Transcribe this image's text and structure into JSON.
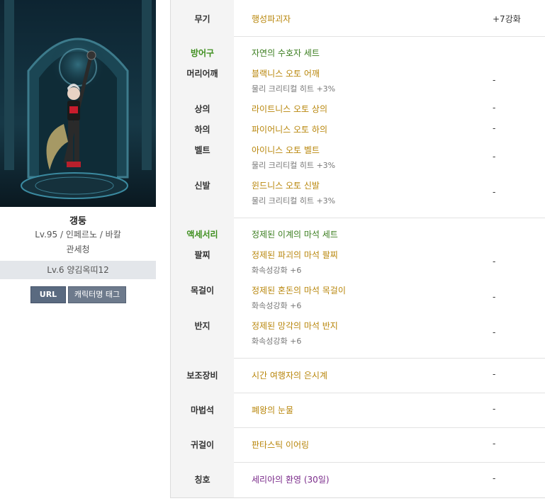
{
  "character": {
    "name": "갱둥",
    "info": "Lv.95 / 인페르노 / 바칼",
    "guild": "관세청",
    "mercenary": "Lv.6 양김옥띠12",
    "buttons": {
      "url": "URL",
      "tag": "캐릭터명 태그"
    }
  },
  "weapon": {
    "slot": "무기",
    "name": "행성파괴자",
    "value": "+7강화"
  },
  "armor": {
    "category": "방어구",
    "set_name": "자연의 수호자 세트",
    "items": [
      {
        "slot": "머리어깨",
        "name": "블랙니스 오토 어깨",
        "sub": "물리 크리티컬 히트 +3%",
        "value": "-"
      },
      {
        "slot": "상의",
        "name": "라이트니스 오토 상의",
        "sub": "",
        "value": "-"
      },
      {
        "slot": "하의",
        "name": "파이어니스 오토 하의",
        "sub": "",
        "value": "-"
      },
      {
        "slot": "벨트",
        "name": "아이니스 오토 벨트",
        "sub": "물리 크리티컬 히트 +3%",
        "value": "-"
      },
      {
        "slot": "신발",
        "name": "윈드니스 오토 신발",
        "sub": "물리 크리티컬 히트 +3%",
        "value": "-"
      }
    ]
  },
  "accessory": {
    "category": "액세서리",
    "set_name": "정제된 이계의 마석 세트",
    "items": [
      {
        "slot": "팔찌",
        "name": "정제된 파괴의 마석 팔찌",
        "sub": "화속성강화 +6",
        "value": "-"
      },
      {
        "slot": "목걸이",
        "name": "정제된 혼돈의 마석 목걸이",
        "sub": "화속성강화 +6",
        "value": "-"
      },
      {
        "slot": "반지",
        "name": "정제된 망각의 마석 반지",
        "sub": "화속성강화 +6",
        "value": "-"
      }
    ]
  },
  "others": [
    {
      "slot": "보조장비",
      "name": "시간 여행자의 은시계",
      "value": "-"
    },
    {
      "slot": "마법석",
      "name": "폐왕의 눈물",
      "value": "-"
    },
    {
      "slot": "귀걸이",
      "name": "판타스틱 이어링",
      "value": "-"
    },
    {
      "slot": "칭호",
      "name": "세리아의 환영 (30일)",
      "value": "-"
    }
  ]
}
